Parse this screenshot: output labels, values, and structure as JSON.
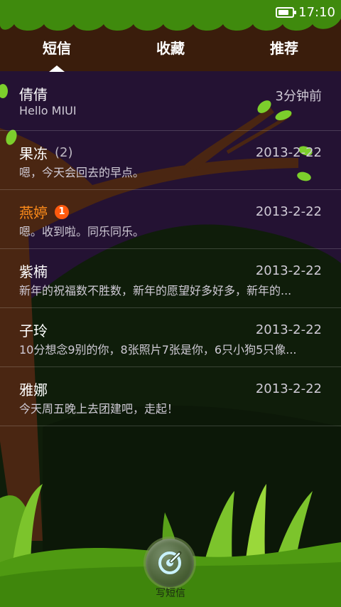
{
  "status": {
    "time": "17:10",
    "battery_level": 0.9
  },
  "tabs": [
    {
      "label": "短信",
      "active": true
    },
    {
      "label": "收藏",
      "active": false
    },
    {
      "label": "推荐",
      "active": false
    }
  ],
  "conversations": [
    {
      "name": "倩倩",
      "count": "",
      "badge": "",
      "time": "3分钟前",
      "preview": "Hello MIUI",
      "unread": false
    },
    {
      "name": "果冻",
      "count": "(2)",
      "badge": "",
      "time": "2013-2-22",
      "preview": "嗯，今天会回去的早点。",
      "unread": false
    },
    {
      "name": "燕婷",
      "count": "",
      "badge": "1",
      "time": "2013-2-22",
      "preview": "嗯。收到啦。同乐同乐。",
      "unread": true
    },
    {
      "name": "紫楠",
      "count": "",
      "badge": "",
      "time": "2013-2-22",
      "preview": "新年的祝福数不胜数，新年的愿望好多好多，新年的...",
      "unread": false
    },
    {
      "name": "子玲",
      "count": "",
      "badge": "",
      "time": "2013-2-22",
      "preview": "10分想念9别的你，8张照片7张是你，6只小狗5只像...",
      "unread": false
    },
    {
      "name": "雅娜",
      "count": "",
      "badge": "",
      "time": "2013-2-22",
      "preview": "今天周五晚上去团建吧，走起！",
      "unread": false
    }
  ],
  "compose": {
    "label": "写短信",
    "icon": "compose-icon"
  },
  "colors": {
    "header": "#3a1d0c",
    "background": "#241233",
    "unread_name": "#ff8c1a",
    "badge": "#ff5a0e",
    "grass": "#4f9a12"
  }
}
